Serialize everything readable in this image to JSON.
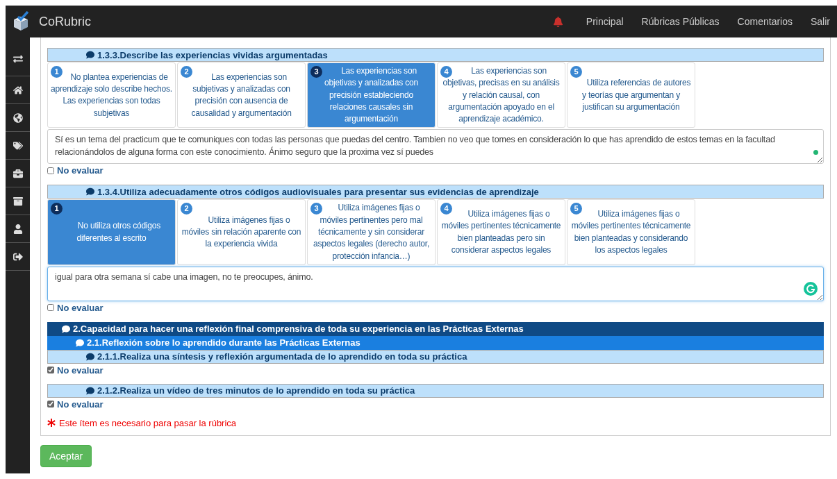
{
  "navbar": {
    "brand": "CoRubric",
    "links": [
      "Principal",
      "Rúbricas Públicas",
      "Comentarios",
      "Salir"
    ]
  },
  "rubric": [
    {
      "kind": "criterion",
      "title": "1.3.3.Describe las experiencias vividas argumentadas",
      "descriptors": [
        {
          "number": "1",
          "text": "No plantea experiencias de aprendizaje solo describe hechos. Las experiencias son todas subjetivas",
          "selected": false
        },
        {
          "number": "2",
          "text": "Las experiencias son subjetivas y analizadas con precisión con ausencia de causalidad y argumentación",
          "selected": false
        },
        {
          "number": "3",
          "text": "Las experiencias son objetivas y analizadas con precisión estableciendo relaciones causales sin argumentación",
          "selected": true
        },
        {
          "number": "4",
          "text": "Las experiencias son objetivas, precisas en su análisis y relación causal, con argumentación apoyado en el aprendizaje académico.",
          "selected": false
        },
        {
          "number": "5",
          "text": "Utiliza referencias de autores y teorías que argumentan y justifican su argumentación",
          "selected": false
        }
      ],
      "comment": {
        "value": "Sí es un tema del practicum que te comuniques con todas las personas que puedas del centro. Tambien no veo que tomes en consideración lo que has aprendido de estos temas en la facultad relacionándolos de alguna forma con este conocimiento. Ánimo seguro que la proxima vez sí puedes",
        "assistant_active": false,
        "focused": false
      },
      "skip": {
        "label": "No evaluar",
        "checked": false
      }
    },
    {
      "kind": "criterion",
      "title": "1.3.4.Utiliza adecuadamente otros códigos audiovisuales para presentar sus evidencias de aprendizaje",
      "descriptors": [
        {
          "number": "1",
          "text": "No utiliza otros códigos diferentes al escrito",
          "selected": true
        },
        {
          "number": "2",
          "text": "Utiliza imágenes fijas o móviles sin relación aparente con la experiencia vivida",
          "selected": false
        },
        {
          "number": "3",
          "text": "Utiliza imágenes fijas o móviles pertinentes pero mal técnicamente y sin considerar aspectos legales (derecho autor, protección infancia…)",
          "selected": false
        },
        {
          "number": "4",
          "text": "Utiliza imágenes fijas o móviles pertinentes técnicamente bien planteadas pero sin considerar aspectos legales",
          "selected": false
        },
        {
          "number": "5",
          "text": "Utiliza imágenes fijas o móviles pertinentes técnicamente bien planteadas y considerando los aspectos legales",
          "selected": false
        }
      ],
      "comment": {
        "value": "igual para otra semana sí cabe una imagen, no te preocupes, ánimo.",
        "assistant_active": true,
        "focused": true
      },
      "skip": {
        "label": "No evaluar",
        "checked": false
      }
    },
    {
      "kind": "section",
      "title": "2.Capacidad para hacer una reflexión final comprensiva de toda su experiencia en las Prácticas Externas",
      "children": [
        {
          "kind": "subsection",
          "title": "2.1.Reflexión sobre lo aprendido durante las Prácticas Externas",
          "children": [
            {
              "kind": "criterion",
              "title": "2.1.1.Realiza una síntesis y reflexión argumentada de lo aprendido en toda su práctica",
              "skip": {
                "label": "No evaluar",
                "checked": true
              }
            },
            {
              "kind": "criterion",
              "title": "2.1.2.Realiza un vídeo de tres minutos de lo aprendido en toda su práctica",
              "skip": {
                "label": "No evaluar",
                "checked": true
              }
            }
          ]
        }
      ]
    }
  ],
  "note": "Este ítem es necesario para pasar la rúbrica",
  "submit": "Aceptar"
}
